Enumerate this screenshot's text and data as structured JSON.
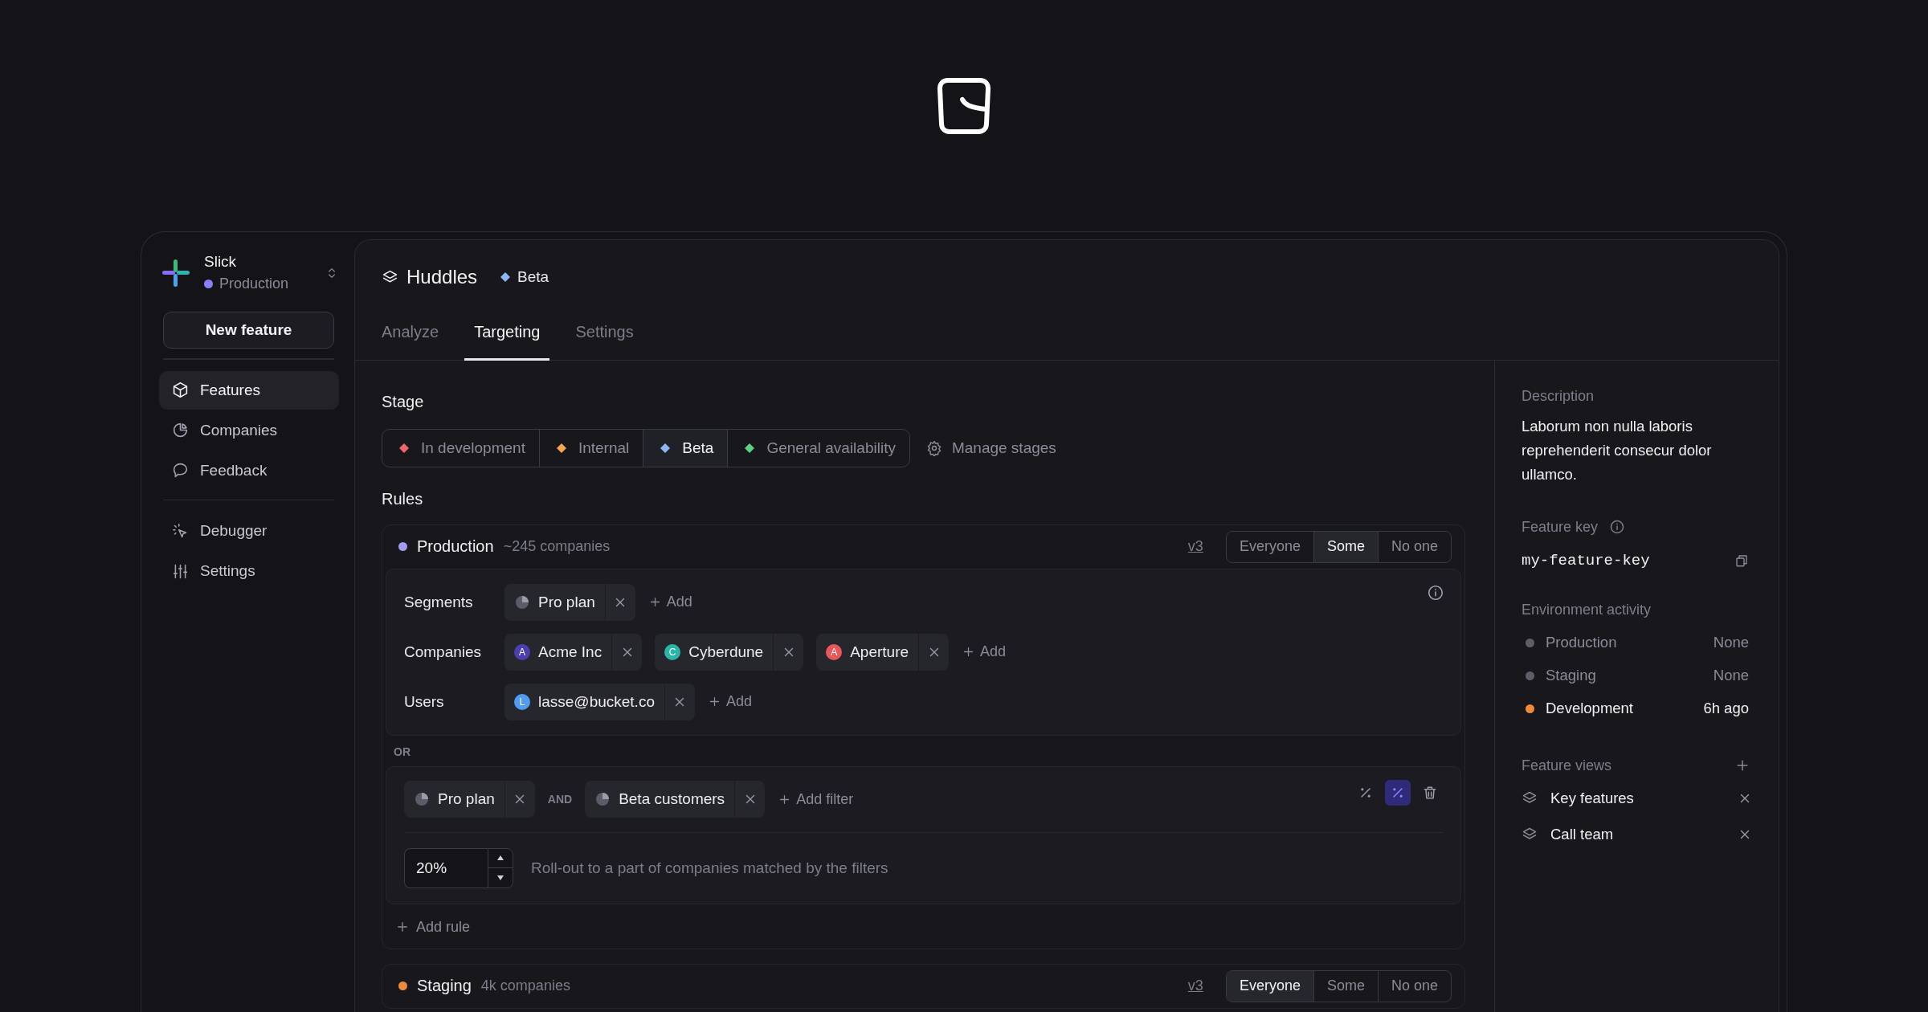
{
  "workspace": {
    "name": "Slick",
    "environment": "Production"
  },
  "new_feature_button": "New feature",
  "sidebar": {
    "groups": [
      [
        {
          "label": "Features",
          "kind": "cube",
          "selected": true
        },
        {
          "label": "Companies",
          "kind": "pie",
          "selected": false
        },
        {
          "label": "Feedback",
          "kind": "chat",
          "selected": false
        }
      ],
      [
        {
          "label": "Debugger",
          "kind": "cursor",
          "selected": false
        },
        {
          "label": "Settings",
          "kind": "sliders",
          "selected": false
        }
      ]
    ]
  },
  "feature": {
    "name": "Huddles",
    "stage": "Beta"
  },
  "tabs": [
    {
      "label": "Analyze",
      "selected": false
    },
    {
      "label": "Targeting",
      "selected": true
    },
    {
      "label": "Settings",
      "selected": false
    }
  ],
  "stage": {
    "title": "Stage",
    "options": [
      {
        "label": "In development",
        "color": "#f0646a",
        "selected": false
      },
      {
        "label": "Internal",
        "color": "#f5a54a",
        "selected": false
      },
      {
        "label": "Beta",
        "color": "#8ab8f5",
        "selected": true
      },
      {
        "label": "General availability",
        "color": "#5fcf82",
        "selected": false
      }
    ],
    "manage_button": "Manage stages"
  },
  "rules": {
    "title": "Rules",
    "environments": [
      {
        "name": "Production",
        "color": "#a29af5",
        "companies": "~245 companies",
        "version": "v3",
        "modes": [
          {
            "label": "Everyone",
            "selected": false
          },
          {
            "label": "Some",
            "selected": true
          },
          {
            "label": "No one",
            "selected": false
          }
        ],
        "targets": [
          {
            "label": "Segments",
            "chips": [
              {
                "kind": "segment",
                "label": "Pro plan"
              }
            ],
            "add_button": "Add"
          },
          {
            "label": "Companies",
            "chips": [
              {
                "kind": "company",
                "avatar": "A",
                "color": "#4b3fb0",
                "label": "Acme Inc"
              },
              {
                "kind": "company",
                "avatar": "C",
                "color": "#2bb5a8",
                "label": "Cyberdune"
              },
              {
                "kind": "company",
                "avatar": "A",
                "color": "#e8585a",
                "label": "Aperture"
              }
            ],
            "add_button": "Add"
          },
          {
            "label": "Users",
            "chips": [
              {
                "kind": "company",
                "avatar": "L",
                "color": "#4f9cf0",
                "label": "lasse@bucket.co"
              }
            ],
            "add_button": "Add"
          }
        ],
        "or_label": "OR",
        "filter_rule": {
          "filters": [
            {
              "label": "Pro plan"
            },
            {
              "label": "Beta customers"
            }
          ],
          "joiner": "AND",
          "add_filter_button": "Add filter",
          "tools": [
            {
              "kind": "percent",
              "selected": false
            },
            {
              "kind": "percent",
              "selected": true
            },
            {
              "kind": "delete",
              "selected": false
            }
          ],
          "rollout": "20%",
          "rollout_text": "Roll-out to a part of companies matched by the filters"
        },
        "add_rule_button": "Add rule"
      },
      {
        "name": "Staging",
        "color": "#f08a3a",
        "companies": "4k companies",
        "version": "v3",
        "modes": [
          {
            "label": "Everyone",
            "selected": true
          },
          {
            "label": "Some",
            "selected": false
          },
          {
            "label": "No one",
            "selected": false
          }
        ]
      }
    ]
  },
  "details": {
    "description": {
      "label": "Description",
      "text": "Laborum non nulla laboris reprehenderit consecur dolor ullamco."
    },
    "feature_key": {
      "label": "Feature key",
      "value": "my-feature-key"
    },
    "environment_activity": {
      "label": "Environment activity",
      "items": [
        {
          "name": "Production",
          "time": "None",
          "color": "#5c5e6b",
          "active": false
        },
        {
          "name": "Staging",
          "time": "None",
          "color": "#5c5e6b",
          "active": false
        },
        {
          "name": "Development",
          "time": "6h ago",
          "color": "#f08a3a",
          "active": true
        }
      ]
    },
    "feature_views": {
      "label": "Feature views",
      "items": [
        {
          "name": "Key features"
        },
        {
          "name": "Call team"
        }
      ]
    }
  }
}
